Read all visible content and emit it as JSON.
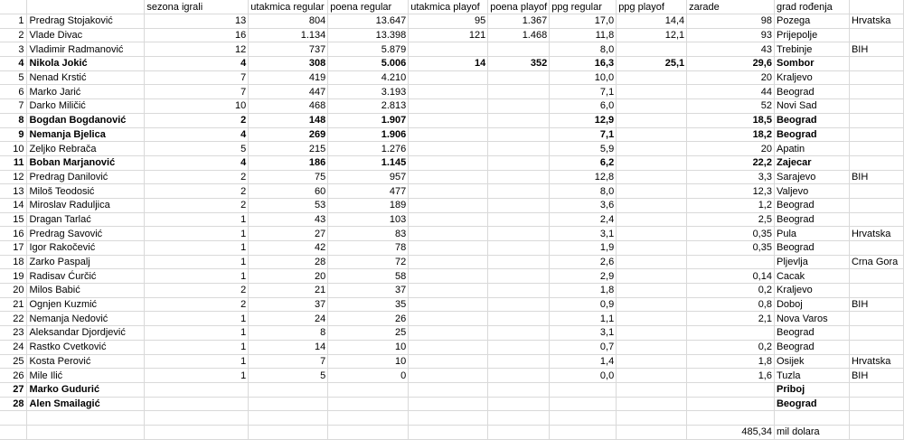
{
  "headers": [
    "",
    "",
    "sezona igrali",
    "utakmica regular",
    "poena regular",
    "utakmica playof",
    "poena playof",
    "ppg regular",
    "ppg playof",
    "zarade",
    "grad rođenja",
    ""
  ],
  "rows": [
    {
      "i": "1",
      "name": "Predrag Stojaković",
      "sez": "13",
      "utr": "804",
      "por": "13.647",
      "utp": "95",
      "pop": "1.367",
      "ppgr": "17,0",
      "ppgp": "14,4",
      "zar": "98",
      "grad": "Pozega",
      "drz": "Hrvatska",
      "bold": false
    },
    {
      "i": "2",
      "name": "Vlade Divac",
      "sez": "16",
      "utr": "1.134",
      "por": "13.398",
      "utp": "121",
      "pop": "1.468",
      "ppgr": "11,8",
      "ppgp": "12,1",
      "zar": "93",
      "grad": "Prijepolje",
      "drz": "",
      "bold": false
    },
    {
      "i": "3",
      "name": "Vladimir Radmanović",
      "sez": "12",
      "utr": "737",
      "por": "5.879",
      "utp": "",
      "pop": "",
      "ppgr": "8,0",
      "ppgp": "",
      "zar": "43",
      "grad": "Trebinje",
      "drz": "BIH",
      "bold": false
    },
    {
      "i": "4",
      "name": "Nikola Jokić",
      "sez": "4",
      "utr": "308",
      "por": "5.006",
      "utp": "14",
      "pop": "352",
      "ppgr": "16,3",
      "ppgp": "25,1",
      "zar": "29,6",
      "grad": "Sombor",
      "drz": "",
      "bold": true
    },
    {
      "i": "5",
      "name": "Nenad Krstić",
      "sez": "7",
      "utr": "419",
      "por": "4.210",
      "utp": "",
      "pop": "",
      "ppgr": "10,0",
      "ppgp": "",
      "zar": "20",
      "grad": "Kraljevo",
      "drz": "",
      "bold": false
    },
    {
      "i": "6",
      "name": "Marko Jarić",
      "sez": "7",
      "utr": "447",
      "por": "3.193",
      "utp": "",
      "pop": "",
      "ppgr": "7,1",
      "ppgp": "",
      "zar": "44",
      "grad": "Beograd",
      "drz": "",
      "bold": false
    },
    {
      "i": "7",
      "name": "Darko Miličić",
      "sez": "10",
      "utr": "468",
      "por": "2.813",
      "utp": "",
      "pop": "",
      "ppgr": "6,0",
      "ppgp": "",
      "zar": "52",
      "grad": "Novi Sad",
      "drz": "",
      "bold": false
    },
    {
      "i": "8",
      "name": "Bogdan Bogdanović",
      "sez": "2",
      "utr": "148",
      "por": "1.907",
      "utp": "",
      "pop": "",
      "ppgr": "12,9",
      "ppgp": "",
      "zar": "18,5",
      "grad": "Beograd",
      "drz": "",
      "bold": true
    },
    {
      "i": "9",
      "name": "Nemanja Bjelica",
      "sez": "4",
      "utr": "269",
      "por": "1.906",
      "utp": "",
      "pop": "",
      "ppgr": "7,1",
      "ppgp": "",
      "zar": "18,2",
      "grad": "Beograd",
      "drz": "",
      "bold": true
    },
    {
      "i": "10",
      "name": "Zeljko Rebrača",
      "sez": "5",
      "utr": "215",
      "por": "1.276",
      "utp": "",
      "pop": "",
      "ppgr": "5,9",
      "ppgp": "",
      "zar": "20",
      "grad": "Apatin",
      "drz": "",
      "bold": false
    },
    {
      "i": "11",
      "name": "Boban Marjanović",
      "sez": "4",
      "utr": "186",
      "por": "1.145",
      "utp": "",
      "pop": "",
      "ppgr": "6,2",
      "ppgp": "",
      "zar": "22,2",
      "grad": "Zajecar",
      "drz": "",
      "bold": true
    },
    {
      "i": "12",
      "name": "Predrag Danilović",
      "sez": "2",
      "utr": "75",
      "por": "957",
      "utp": "",
      "pop": "",
      "ppgr": "12,8",
      "ppgp": "",
      "zar": "3,3",
      "grad": "Sarajevo",
      "drz": "BIH",
      "bold": false
    },
    {
      "i": "13",
      "name": "Miloš Teodosić",
      "sez": "2",
      "utr": "60",
      "por": "477",
      "utp": "",
      "pop": "",
      "ppgr": "8,0",
      "ppgp": "",
      "zar": "12,3",
      "grad": "Valjevo",
      "drz": "",
      "bold": false
    },
    {
      "i": "14",
      "name": "Miroslav Raduljica",
      "sez": "2",
      "utr": "53",
      "por": "189",
      "utp": "",
      "pop": "",
      "ppgr": "3,6",
      "ppgp": "",
      "zar": "1,2",
      "grad": "Beograd",
      "drz": "",
      "bold": false
    },
    {
      "i": "15",
      "name": "Dragan Tarlać",
      "sez": "1",
      "utr": "43",
      "por": "103",
      "utp": "",
      "pop": "",
      "ppgr": "2,4",
      "ppgp": "",
      "zar": "2,5",
      "grad": "Beograd",
      "drz": "",
      "bold": false
    },
    {
      "i": "16",
      "name": "Predrag Savović",
      "sez": "1",
      "utr": "27",
      "por": "83",
      "utp": "",
      "pop": "",
      "ppgr": "3,1",
      "ppgp": "",
      "zar": "0,35",
      "grad": "Pula",
      "drz": "Hrvatska",
      "bold": false
    },
    {
      "i": "17",
      "name": "Igor Rakočević",
      "sez": "1",
      "utr": "42",
      "por": "78",
      "utp": "",
      "pop": "",
      "ppgr": "1,9",
      "ppgp": "",
      "zar": "0,35",
      "grad": "Beograd",
      "drz": "",
      "bold": false
    },
    {
      "i": "18",
      "name": "Zarko Paspalj",
      "sez": "1",
      "utr": "28",
      "por": "72",
      "utp": "",
      "pop": "",
      "ppgr": "2,6",
      "ppgp": "",
      "zar": "",
      "grad": "Pljevlja",
      "drz": "Crna Gora",
      "bold": false
    },
    {
      "i": "19",
      "name": "Radisav Ćurčić",
      "sez": "1",
      "utr": "20",
      "por": "58",
      "utp": "",
      "pop": "",
      "ppgr": "2,9",
      "ppgp": "",
      "zar": "0,14",
      "grad": "Cacak",
      "drz": "",
      "bold": false
    },
    {
      "i": "20",
      "name": "Milos Babić",
      "sez": "2",
      "utr": "21",
      "por": "37",
      "utp": "",
      "pop": "",
      "ppgr": "1,8",
      "ppgp": "",
      "zar": "0,2",
      "grad": "Kraljevo",
      "drz": "",
      "bold": false
    },
    {
      "i": "21",
      "name": "Ognjen Kuzmić",
      "sez": "2",
      "utr": "37",
      "por": "35",
      "utp": "",
      "pop": "",
      "ppgr": "0,9",
      "ppgp": "",
      "zar": "0,8",
      "grad": "Doboj",
      "drz": "BIH",
      "bold": false
    },
    {
      "i": "22",
      "name": "Nemanja Nedović",
      "sez": "1",
      "utr": "24",
      "por": "26",
      "utp": "",
      "pop": "",
      "ppgr": "1,1",
      "ppgp": "",
      "zar": "2,1",
      "grad": "Nova Varos",
      "drz": "",
      "bold": false
    },
    {
      "i": "23",
      "name": "Aleksandar Djordjević",
      "sez": "1",
      "utr": "8",
      "por": "25",
      "utp": "",
      "pop": "",
      "ppgr": "3,1",
      "ppgp": "",
      "zar": "",
      "grad": "Beograd",
      "drz": "",
      "bold": false
    },
    {
      "i": "24",
      "name": "Rastko Cvetković",
      "sez": "1",
      "utr": "14",
      "por": "10",
      "utp": "",
      "pop": "",
      "ppgr": "0,7",
      "ppgp": "",
      "zar": "0,2",
      "grad": "Beograd",
      "drz": "",
      "bold": false
    },
    {
      "i": "25",
      "name": "Kosta Perović",
      "sez": "1",
      "utr": "7",
      "por": "10",
      "utp": "",
      "pop": "",
      "ppgr": "1,4",
      "ppgp": "",
      "zar": "1,8",
      "grad": "Osijek",
      "drz": "Hrvatska",
      "bold": false
    },
    {
      "i": "26",
      "name": "Mile Ilić",
      "sez": "1",
      "utr": "5",
      "por": "0",
      "utp": "",
      "pop": "",
      "ppgr": "0,0",
      "ppgp": "",
      "zar": "1,6",
      "grad": "Tuzla",
      "drz": "BIH",
      "bold": false
    },
    {
      "i": "27",
      "name": "Marko Gudurić",
      "sez": "",
      "utr": "",
      "por": "",
      "utp": "",
      "pop": "",
      "ppgr": "",
      "ppgp": "",
      "zar": "",
      "grad": "Priboj",
      "drz": "",
      "bold": true
    },
    {
      "i": "28",
      "name": "Alen Smailagić",
      "sez": "",
      "utr": "",
      "por": "",
      "utp": "",
      "pop": "",
      "ppgr": "",
      "ppgp": "",
      "zar": "",
      "grad": "Beograd",
      "drz": "",
      "bold": true
    }
  ],
  "total": {
    "zar": "485,34",
    "label": "mil dolara"
  }
}
